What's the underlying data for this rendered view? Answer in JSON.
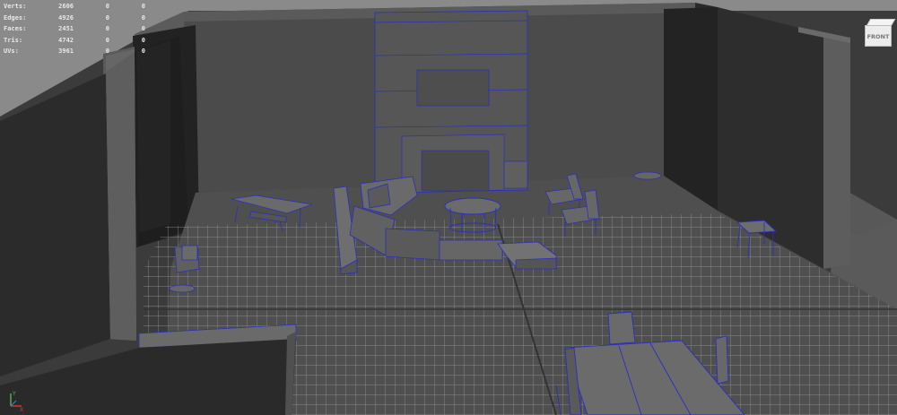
{
  "hud": {
    "rows": [
      {
        "label": "Verts:",
        "v1": "2606",
        "v2": "0",
        "v3": "0"
      },
      {
        "label": "Edges:",
        "v1": "4926",
        "v2": "0",
        "v3": "0"
      },
      {
        "label": "Faces:",
        "v1": "2451",
        "v2": "0",
        "v3": "0"
      },
      {
        "label": "Tris:",
        "v1": "4742",
        "v2": "0",
        "v3": "0"
      },
      {
        "label": "UVs:",
        "v1": "3961",
        "v2": "0",
        "v3": "0"
      }
    ]
  },
  "viewcube": {
    "face_label": "FRONT",
    "icon": "viewcube-icon"
  },
  "axis": {
    "x_label": "X",
    "y_label": "Y",
    "icon": "axis-gizmo-icon"
  },
  "colors": {
    "background": "#8a8a8a",
    "grid": "#9c9c9c",
    "wireframe": "#2a2fbf",
    "wall_dark": "#2e2e2e",
    "wall_mid": "#4e4e4e",
    "floor": "#555555"
  }
}
